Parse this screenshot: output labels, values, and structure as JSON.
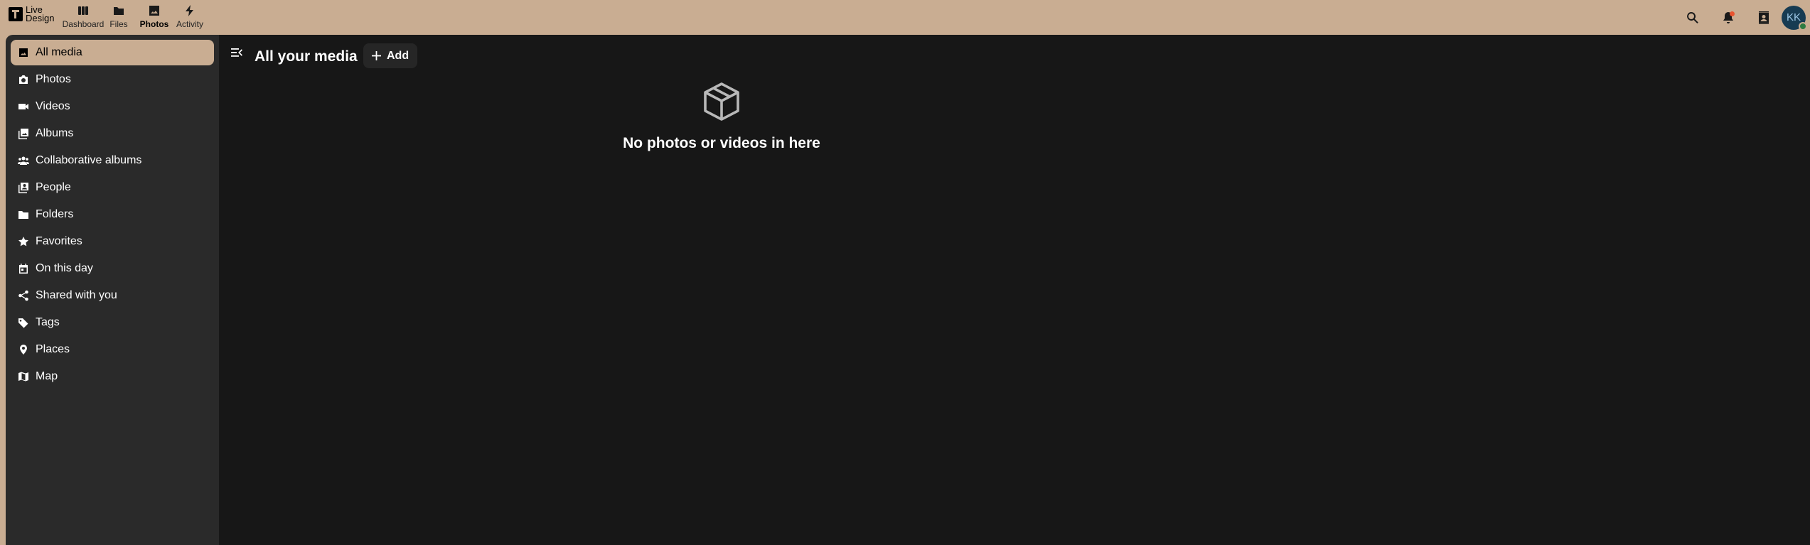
{
  "logo": {
    "line1": "Live",
    "line2": "Design"
  },
  "apps": [
    {
      "label": "Dashboard",
      "icon": "dashboard-icon"
    },
    {
      "label": "Files",
      "icon": "folder-icon"
    },
    {
      "label": "Photos",
      "icon": "image-icon"
    },
    {
      "label": "Activity",
      "icon": "lightning-icon"
    }
  ],
  "header_tools": {
    "avatar_initials": "KK"
  },
  "sidebar": {
    "items": [
      {
        "label": "All media",
        "icon": "image-icon",
        "active": true
      },
      {
        "label": "Photos",
        "icon": "camera-icon"
      },
      {
        "label": "Videos",
        "icon": "video-icon"
      },
      {
        "label": "Albums",
        "icon": "albums-icon"
      },
      {
        "label": "Collaborative albums",
        "icon": "group-icon"
      },
      {
        "label": "People",
        "icon": "people-icon"
      },
      {
        "label": "Folders",
        "icon": "folder-icon"
      },
      {
        "label": "Favorites",
        "icon": "star-icon"
      },
      {
        "label": "On this day",
        "icon": "calendar-icon"
      },
      {
        "label": "Shared with you",
        "icon": "share-icon"
      },
      {
        "label": "Tags",
        "icon": "tag-icon"
      },
      {
        "label": "Places",
        "icon": "location-pin-icon"
      },
      {
        "label": "Map",
        "icon": "map-icon"
      }
    ]
  },
  "main": {
    "title": "All your media",
    "add_label": "Add",
    "empty_message": "No photos or videos in here"
  },
  "colors": {
    "header": "#c9ad92",
    "sidebar": "#2a2a2a",
    "main": "#171717",
    "accent": "#c9ad92",
    "notification": "#e8532f"
  }
}
